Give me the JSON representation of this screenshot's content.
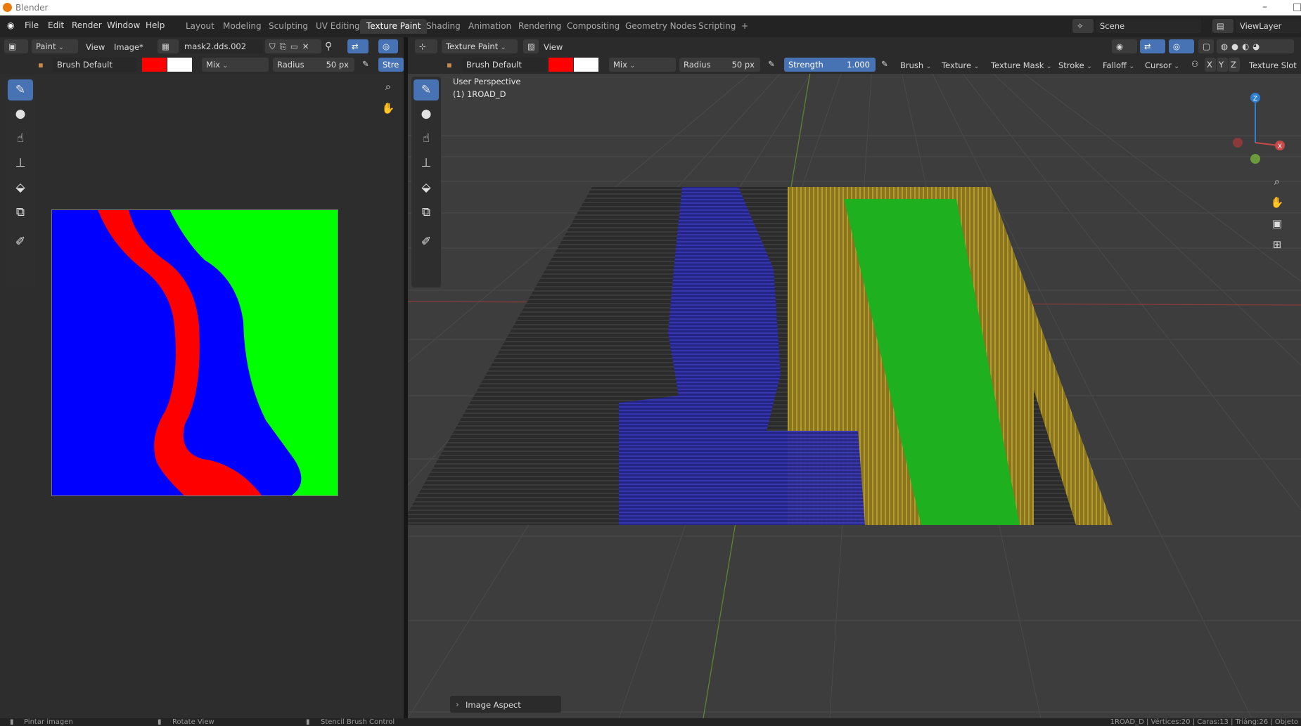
{
  "window": {
    "title": "Blender"
  },
  "menu": [
    "File",
    "Edit",
    "Render",
    "Window",
    "Help"
  ],
  "workspaces": [
    "Layout",
    "Modeling",
    "Sculpting",
    "UV Editing",
    "Texture Paint",
    "Shading",
    "Animation",
    "Rendering",
    "Compositing",
    "Geometry Nodes",
    "Scripting",
    "+"
  ],
  "scene": {
    "name": "Scene",
    "view_layer": "ViewLayer"
  },
  "image_editor": {
    "mode": "Paint",
    "view_menu": "View",
    "image_menu": "Image*",
    "image_name": "mask2.dds.002",
    "brush": "Brush Default",
    "blend": "Mix",
    "radius_label": "Radius",
    "radius_value": "50 px",
    "strength_cut": "Stre"
  },
  "viewport": {
    "mode": "Texture Paint",
    "view_menu": "View",
    "brush": "Brush Default",
    "blend": "Mix",
    "radius_label": "Radius",
    "radius_value": "50 px",
    "strength_label": "Strength",
    "strength_value": "1.000",
    "menus": [
      "Brush",
      "Texture",
      "Texture Mask",
      "Stroke",
      "Falloff",
      "Cursor"
    ],
    "axes": [
      "X",
      "Y",
      "Z"
    ],
    "texture_slots": "Texture Slot",
    "perspective": "User Perspective",
    "object": "(1) 1ROAD_D",
    "last_op": "Image Aspect"
  },
  "gizmo": {
    "x": "X",
    "z": "Z"
  },
  "status": {
    "left": "Pintar imagen",
    "middle": "Rotate View",
    "right": "Stencil Brush Control",
    "stats": "1ROAD_D | Vértices:20 | Caras:13 | Triáng:26 | Objeto"
  },
  "colors": {
    "primary": "#ff0000",
    "secondary": "#ffffff",
    "accent": "#4772b3"
  }
}
